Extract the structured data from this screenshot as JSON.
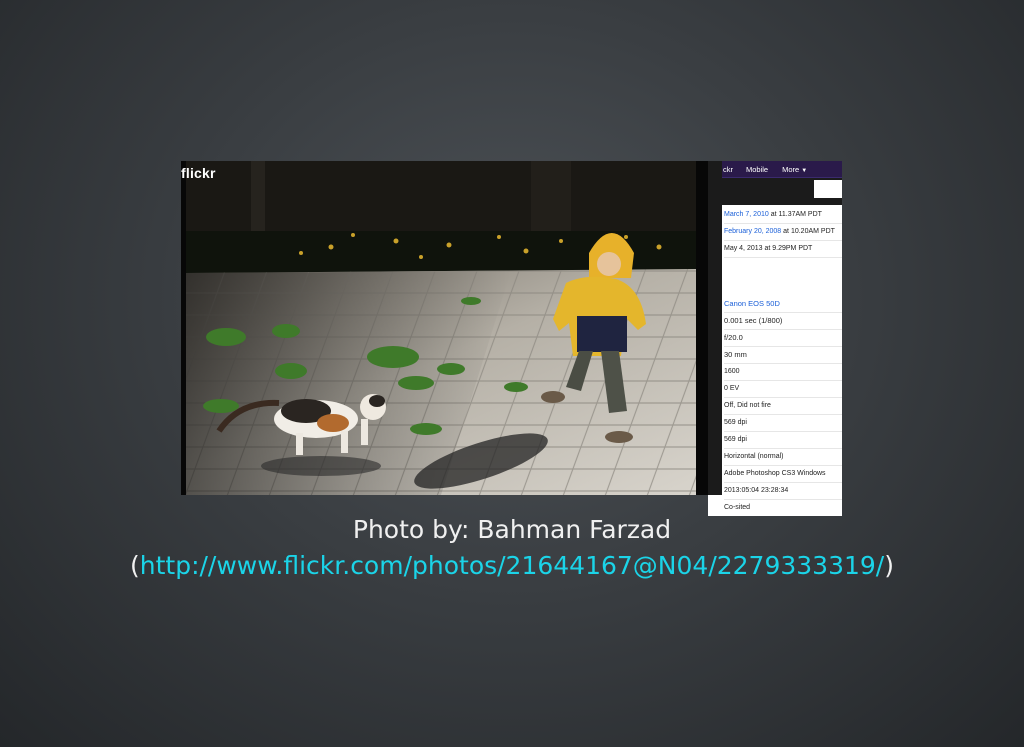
{
  "screenshot": {
    "logo": "flickr",
    "nav": [
      "ckr",
      "Mobile",
      "More"
    ],
    "nav_more_icon": "chevron-down-icon",
    "dates": [
      {
        "link": "March 7, 2010",
        "rest": "at 11.37AM PDT"
      },
      {
        "link": "February 20, 2008",
        "rest": "at 10.20AM PDT"
      },
      {
        "link": "",
        "rest": "May 4, 2013 at 9.29PM PDT"
      }
    ],
    "camera": "Canon EOS 50D",
    "exif": [
      "0.001 sec (1/800)",
      "f/20.0",
      "30 mm",
      "1600",
      "0 EV",
      "Off, Did not fire",
      "569 dpi",
      "569 dpi",
      "Horizontal (normal)",
      "Adobe Photoshop CS3 Windows",
      "2013:05:04 23:28:34",
      "Co-sited"
    ]
  },
  "caption": {
    "line1": "Photo by: Bahman Farzad",
    "open_paren": "(",
    "link": "http://www.flickr.com/photos/21644167@N04/2279333319/",
    "close_paren": ")"
  },
  "colors": {
    "link": "#1bd4e8",
    "flickr_link": "#1a5fd8",
    "nav_bar": "#2a1a4a"
  }
}
